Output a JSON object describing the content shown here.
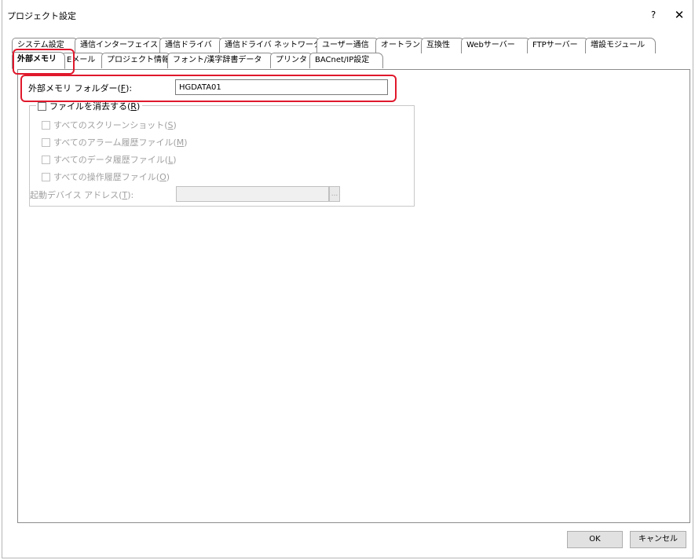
{
  "window": {
    "title": "プロジェクト設定",
    "help_label": "?",
    "close_label": "✕"
  },
  "tabs": {
    "row1": [
      "システム設定",
      "通信インターフェイス",
      "通信ドライバ",
      "通信ドライバ ネットワーク",
      "ユーザー通信",
      "オートラン",
      "互換性",
      "Webサーバー",
      "FTPサーバー",
      "増設モジュール"
    ],
    "row2": [
      "外部メモリ",
      "Eメール",
      "プロジェクト情報",
      "フォント/漢字辞書データ",
      "プリンタ",
      "BACnet/IP設定"
    ],
    "active": "外部メモリ"
  },
  "external_memory": {
    "folder_label_pre": "外部メモリ フォルダー(",
    "folder_label_key": "F",
    "folder_label_post": "):",
    "folder_value": "HGDATA01",
    "delete_files": {
      "label_pre": "ファイルを消去する(",
      "label_key": "R",
      "label_post": ")",
      "checked": false
    },
    "options": [
      {
        "pre": "すべてのスクリーンショット(",
        "key": "S",
        "post": ")",
        "checked": false,
        "enabled": false
      },
      {
        "pre": "すべてのアラーム履歴ファイル(",
        "key": "M",
        "post": ")",
        "checked": false,
        "enabled": false
      },
      {
        "pre": "すべてのデータ履歴ファイル(",
        "key": "L",
        "post": ")",
        "checked": false,
        "enabled": false
      },
      {
        "pre": "すべての操作履歴ファイル(",
        "key": "O",
        "post": ")",
        "checked": false,
        "enabled": false
      }
    ],
    "trigger_address": {
      "label_pre": "起動デバイス アドレス(",
      "label_key": "T",
      "label_post": "):",
      "value": "",
      "browse_label": "..."
    }
  },
  "buttons": {
    "ok": "OK",
    "cancel": "キャンセル"
  },
  "colors": {
    "highlight": "#e0182c",
    "border": "#8c8c8c",
    "disabled_text": "#a0a0a0"
  }
}
